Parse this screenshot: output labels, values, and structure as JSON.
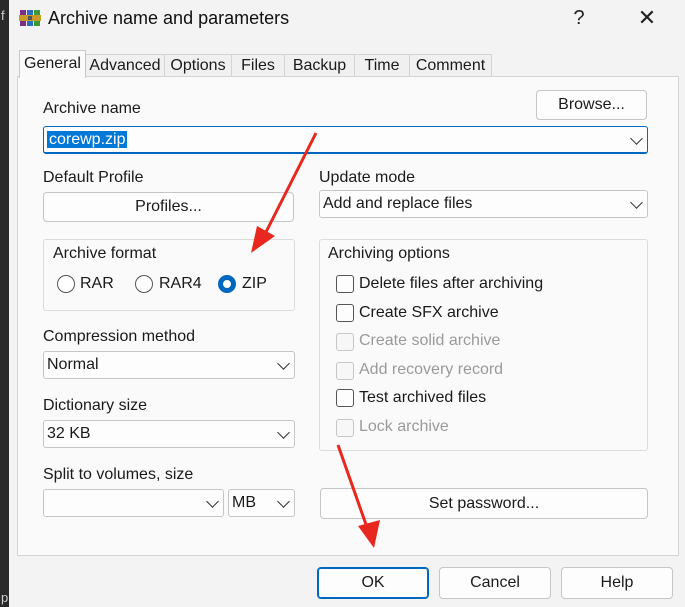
{
  "window": {
    "title": "Archive name and parameters",
    "help_glyph": "?",
    "close_glyph": "✕"
  },
  "edge_chars": [
    "f",
    "p"
  ],
  "tabs": [
    "General",
    "Advanced",
    "Options",
    "Files",
    "Backup",
    "Time",
    "Comment"
  ],
  "archive_name": {
    "label": "Archive name",
    "value": "corewp.zip",
    "browse_label": "Browse..."
  },
  "default_profile": {
    "label": "Default Profile",
    "button_label": "Profiles..."
  },
  "update_mode": {
    "label": "Update mode",
    "value": "Add and replace files"
  },
  "archive_format": {
    "label": "Archive format",
    "options": [
      "RAR",
      "RAR4",
      "ZIP"
    ],
    "selected": "ZIP"
  },
  "compression_method": {
    "label": "Compression method",
    "value": "Normal"
  },
  "dictionary_size": {
    "label": "Dictionary size",
    "value": "32 KB"
  },
  "split_volumes": {
    "label": "Split to volumes, size",
    "value": "",
    "unit": "MB"
  },
  "archiving_options": {
    "label": "Archiving options",
    "items": [
      {
        "label": "Delete files after archiving",
        "checked": false,
        "enabled": true
      },
      {
        "label": "Create SFX archive",
        "checked": false,
        "enabled": true
      },
      {
        "label": "Create solid archive",
        "checked": false,
        "enabled": false
      },
      {
        "label": "Add recovery record",
        "checked": false,
        "enabled": false
      },
      {
        "label": "Test archived files",
        "checked": false,
        "enabled": true
      },
      {
        "label": "Lock archive",
        "checked": false,
        "enabled": false
      }
    ]
  },
  "set_password_label": "Set password...",
  "footer": {
    "ok": "OK",
    "cancel": "Cancel",
    "help": "Help"
  },
  "colors": {
    "accent": "#0067c0",
    "annotation_arrow": "#e8281e"
  }
}
